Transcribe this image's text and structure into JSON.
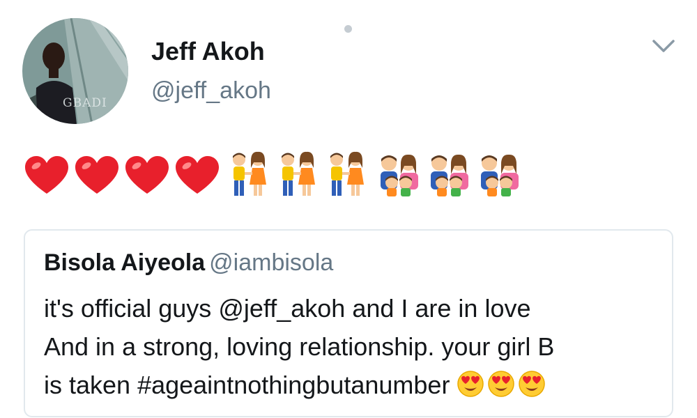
{
  "tweet": {
    "author_name": "Jeff Akoh",
    "author_handle": "@jeff_akoh",
    "avatar_watermark": "GBADI",
    "emojis": {
      "hearts": [
        "red-heart",
        "red-heart",
        "red-heart",
        "red-heart"
      ],
      "couples": [
        "couple-holding-hands",
        "couple-holding-hands",
        "couple-holding-hands"
      ],
      "families": [
        "family",
        "family",
        "family"
      ]
    }
  },
  "quoted_tweet": {
    "author_name": "Bisola Aiyeola",
    "author_handle": "@iambisola",
    "text_lines": [
      "it's official guys @jeff_akoh and I are in love",
      "And in a strong, loving relationship. your girl B",
      "is taken #ageaintnothingbutanumber"
    ],
    "trailing_emojis": [
      "heart-eyes-face",
      "heart-eyes-face",
      "heart-eyes-face"
    ]
  },
  "colors": {
    "text_primary": "#14171a",
    "text_secondary": "#657786",
    "border": "#e1e8ed",
    "heart": "#e8202c"
  }
}
